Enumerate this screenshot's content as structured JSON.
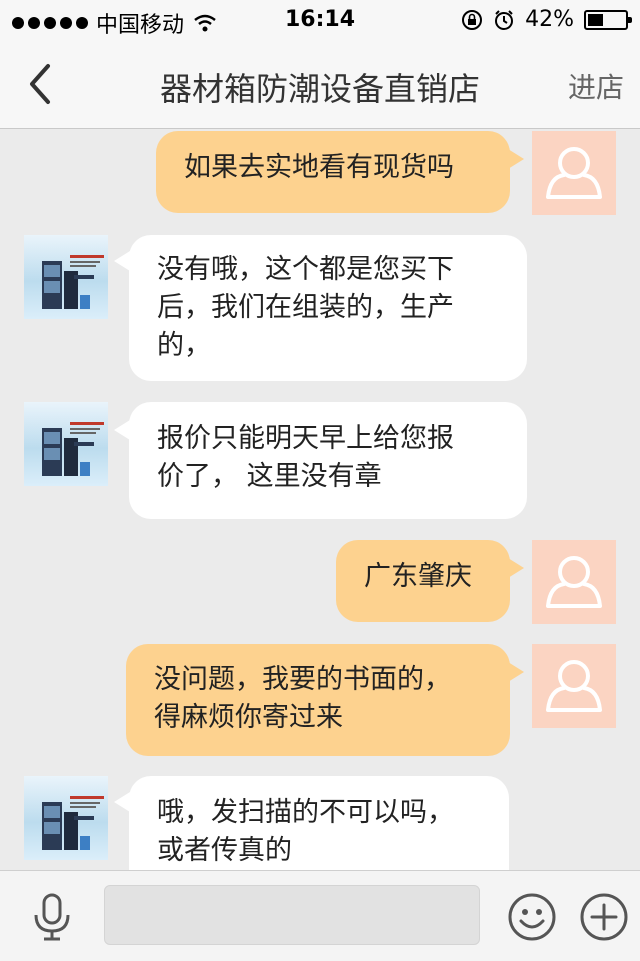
{
  "status_bar": {
    "carrier": "中国移动",
    "time": "16:14",
    "battery_percent": "42%",
    "battery_level": 0.42
  },
  "nav": {
    "title": "器材箱防潮设备直销店",
    "action": "进店",
    "back_icon": "chevron-left-icon"
  },
  "messages": [
    {
      "side": "right",
      "sender": "user",
      "text_lines": [
        "如果去实地看有现货吗"
      ]
    },
    {
      "side": "left",
      "sender": "shop",
      "text_lines": [
        "没有哦，这个都是您买下",
        "后，我们在组装的，生产",
        "的，"
      ]
    },
    {
      "side": "left",
      "sender": "shop",
      "text_lines": [
        "报价只能明天早上给您报",
        "价了， 这里没有章"
      ]
    },
    {
      "side": "right",
      "sender": "user",
      "text_lines": [
        "广东肇庆"
      ]
    },
    {
      "side": "right",
      "sender": "user",
      "text_lines": [
        "没问题，我要的书面的，",
        "得麻烦你寄过来"
      ]
    },
    {
      "side": "left",
      "sender": "shop",
      "text_lines": [
        "哦，发扫描的不可以吗，",
        "或者传真的"
      ]
    }
  ],
  "input_bar": {
    "mic_icon": "microphone-icon",
    "emoji_icon": "smiley-icon",
    "plus_icon": "plus-icon",
    "input_value": "",
    "input_placeholder": ""
  },
  "colors": {
    "user_bubble": "#fdd28f",
    "shop_bubble": "#ffffff",
    "user_avatar_bg": "#fbd4c2",
    "chat_bg": "#ebebeb"
  }
}
